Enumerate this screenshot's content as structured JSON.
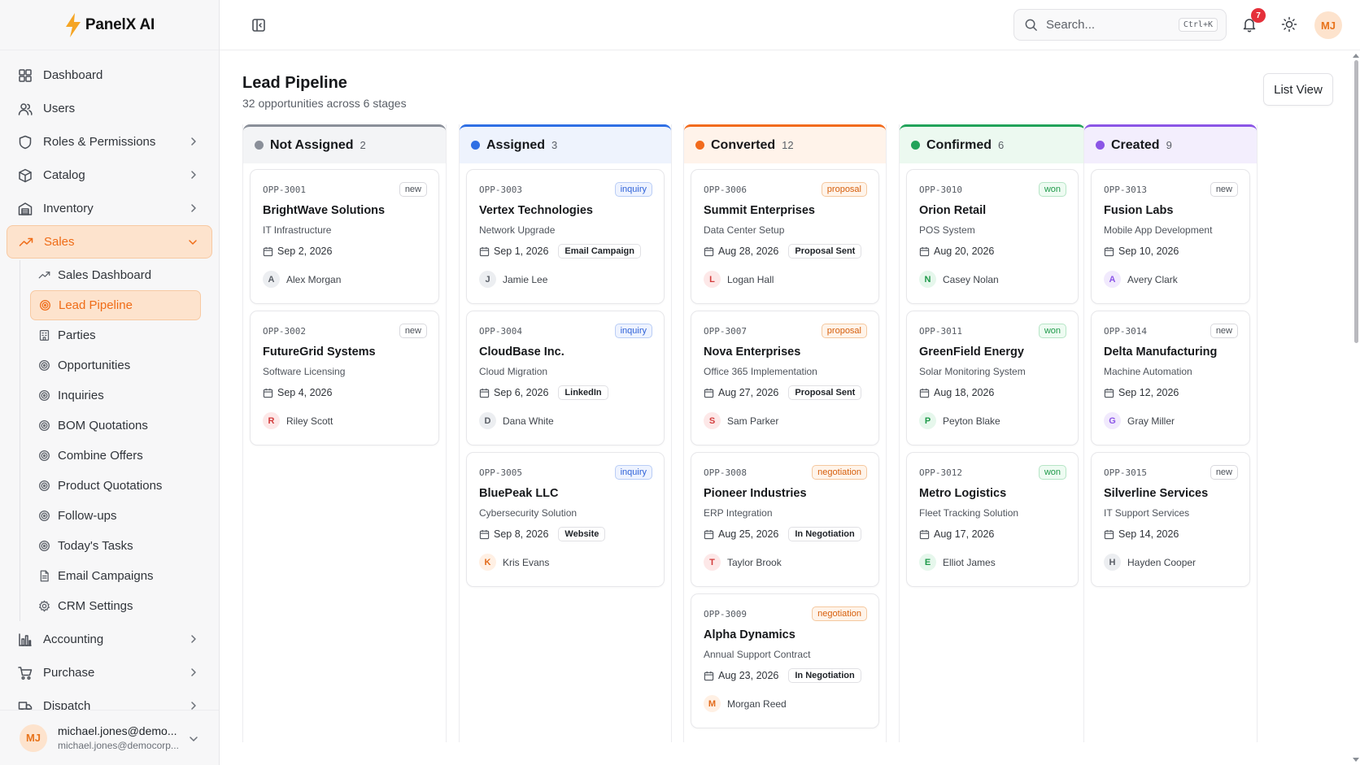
{
  "app": {
    "name": "PanelX AI"
  },
  "sidebar": {
    "items": [
      {
        "label": "Dashboard",
        "icon": "dashboard-icon",
        "has_chevron": false
      },
      {
        "label": "Users",
        "icon": "users-icon",
        "has_chevron": false
      },
      {
        "label": "Roles & Permissions",
        "icon": "shield-icon",
        "has_chevron": true
      },
      {
        "label": "Catalog",
        "icon": "box-icon",
        "has_chevron": true
      },
      {
        "label": "Inventory",
        "icon": "warehouse-icon",
        "has_chevron": true
      },
      {
        "label": "Sales",
        "icon": "trending-up-icon",
        "has_chevron": true,
        "expanded": true,
        "active": true
      }
    ],
    "sales_sub": [
      {
        "label": "Sales Dashboard",
        "icon": "trending-up-icon"
      },
      {
        "label": "Lead Pipeline",
        "icon": "target-icon",
        "active": true
      },
      {
        "label": "Parties",
        "icon": "building-icon"
      },
      {
        "label": "Opportunities",
        "icon": "target-icon"
      },
      {
        "label": "Inquiries",
        "icon": "target-icon"
      },
      {
        "label": "BOM Quotations",
        "icon": "target-icon"
      },
      {
        "label": "Combine Offers",
        "icon": "target-icon"
      },
      {
        "label": "Product Quotations",
        "icon": "target-icon"
      },
      {
        "label": "Follow-ups",
        "icon": "target-icon"
      },
      {
        "label": "Today's Tasks",
        "icon": "target-icon"
      },
      {
        "label": "Email Campaigns",
        "icon": "document-icon"
      },
      {
        "label": "CRM Settings",
        "icon": "gear-icon"
      }
    ],
    "items_after": [
      {
        "label": "Accounting",
        "icon": "bar-chart-icon",
        "has_chevron": true
      },
      {
        "label": "Purchase",
        "icon": "cart-icon",
        "has_chevron": true
      },
      {
        "label": "Dispatch",
        "icon": "truck-icon",
        "has_chevron": true
      }
    ],
    "user": {
      "initials": "MJ",
      "name": "michael.jones@demo...",
      "email": "michael.jones@democorp..."
    }
  },
  "topbar": {
    "search_placeholder": "Search...",
    "shortcut": "Ctrl+K",
    "notification_count": "7",
    "avatar_initials": "MJ"
  },
  "page": {
    "title": "Lead Pipeline",
    "subtitle": "32 opportunities across 6 stages",
    "list_view_label": "List View"
  },
  "colors": {
    "accent": "#ef6c17",
    "not_assigned": "#8a8f99",
    "assigned": "#2f6fe4",
    "converted": "#f26b1d",
    "confirmed": "#22a35a",
    "created": "#8b55e6"
  },
  "columns": [
    {
      "title": "Not Assigned",
      "count": "2",
      "color": "#8a8f99",
      "head_bg": "#f3f4f6",
      "cards": [
        {
          "id": "OPP-3001",
          "tag": "new",
          "tag_type": "new",
          "name": "BrightWave Solutions",
          "desc": "IT Infrastructure",
          "date": "Sep 2, 2026",
          "source": "",
          "initial": "A",
          "owner": "Alex Morgan",
          "av_bg": "#eceef1",
          "av_fg": "#5a5f67"
        },
        {
          "id": "OPP-3002",
          "tag": "new",
          "tag_type": "new",
          "name": "FutureGrid Systems",
          "desc": "Software Licensing",
          "date": "Sep 4, 2026",
          "source": "",
          "initial": "R",
          "owner": "Riley Scott",
          "av_bg": "#fde8e8",
          "av_fg": "#d23c3c"
        }
      ]
    },
    {
      "title": "Assigned",
      "count": "3",
      "color": "#2f6fe4",
      "head_bg": "#eef3fd",
      "cards": [
        {
          "id": "OPP-3003",
          "tag": "inquiry",
          "tag_type": "inquiry",
          "name": "Vertex Technologies",
          "desc": "Network Upgrade",
          "date": "Sep 1, 2026",
          "source": "Email Campaign",
          "initial": "J",
          "owner": "Jamie Lee",
          "av_bg": "#eceef1",
          "av_fg": "#5a5f67"
        },
        {
          "id": "OPP-3004",
          "tag": "inquiry",
          "tag_type": "inquiry",
          "name": "CloudBase Inc.",
          "desc": "Cloud Migration",
          "date": "Sep 6, 2026",
          "source": "LinkedIn",
          "initial": "D",
          "owner": "Dana White",
          "av_bg": "#eceef1",
          "av_fg": "#5a5f67"
        },
        {
          "id": "OPP-3005",
          "tag": "inquiry",
          "tag_type": "inquiry",
          "name": "BluePeak LLC",
          "desc": "Cybersecurity Solution",
          "date": "Sep 8, 2026",
          "source": "Website",
          "initial": "K",
          "owner": "Kris Evans",
          "av_bg": "#fff0e4",
          "av_fg": "#e26a1a"
        }
      ]
    },
    {
      "title": "Converted",
      "count": "12",
      "color": "#f26b1d",
      "head_bg": "#fff3ea",
      "cards": [
        {
          "id": "OPP-3006",
          "tag": "proposal",
          "tag_type": "proposal",
          "name": "Summit Enterprises",
          "desc": "Data Center Setup",
          "date": "Aug 28, 2026",
          "source": "Proposal Sent",
          "initial": "L",
          "owner": "Logan Hall",
          "av_bg": "#fde8e8",
          "av_fg": "#d23c3c"
        },
        {
          "id": "OPP-3007",
          "tag": "proposal",
          "tag_type": "proposal",
          "name": "Nova Enterprises",
          "desc": "Office 365 Implementation",
          "date": "Aug 27, 2026",
          "source": "Proposal Sent",
          "initial": "S",
          "owner": "Sam Parker",
          "av_bg": "#fde8e8",
          "av_fg": "#d23c3c"
        },
        {
          "id": "OPP-3008",
          "tag": "negotiation",
          "tag_type": "negotiation",
          "name": "Pioneer Industries",
          "desc": "ERP Integration",
          "date": "Aug 25, 2026",
          "source": "In Negotiation",
          "initial": "T",
          "owner": "Taylor Brook",
          "av_bg": "#fde8e8",
          "av_fg": "#d23c3c"
        },
        {
          "id": "OPP-3009",
          "tag": "negotiation",
          "tag_type": "negotiation",
          "name": "Alpha Dynamics",
          "desc": "Annual Support Contract",
          "date": "Aug 23, 2026",
          "source": "In Negotiation",
          "initial": "M",
          "owner": "Morgan Reed",
          "av_bg": "#fff0e4",
          "av_fg": "#e26a1a"
        }
      ]
    },
    {
      "title": "Confirmed",
      "count": "6",
      "color": "#22a35a",
      "head_bg": "#ecf9f0",
      "cards": [
        {
          "id": "OPP-3010",
          "tag": "won",
          "tag_type": "won",
          "name": "Orion Retail",
          "desc": "POS System",
          "date": "Aug 20, 2026",
          "source": "",
          "initial": "N",
          "owner": "Casey Nolan",
          "av_bg": "#e6f7ec",
          "av_fg": "#1f9a4a"
        },
        {
          "id": "OPP-3011",
          "tag": "won",
          "tag_type": "won",
          "name": "GreenField Energy",
          "desc": "Solar Monitoring System",
          "date": "Aug 18, 2026",
          "source": "",
          "initial": "P",
          "owner": "Peyton Blake",
          "av_bg": "#e6f7ec",
          "av_fg": "#1f9a4a"
        },
        {
          "id": "OPP-3012",
          "tag": "won",
          "tag_type": "won",
          "name": "Metro Logistics",
          "desc": "Fleet Tracking Solution",
          "date": "Aug 17, 2026",
          "source": "",
          "initial": "E",
          "owner": "Elliot James",
          "av_bg": "#e6f7ec",
          "av_fg": "#1f9a4a"
        }
      ]
    },
    {
      "title": "Created",
      "count": "9",
      "color": "#8b55e6",
      "head_bg": "#f3eefd",
      "cards": [
        {
          "id": "OPP-3013",
          "tag": "new",
          "tag_type": "new",
          "name": "Fusion Labs",
          "desc": "Mobile App Development",
          "date": "Sep 10, 2026",
          "source": "",
          "initial": "A",
          "owner": "Avery Clark",
          "av_bg": "#f1eafd",
          "av_fg": "#8b55e6"
        },
        {
          "id": "OPP-3014",
          "tag": "new",
          "tag_type": "new",
          "name": "Delta Manufacturing",
          "desc": "Machine Automation",
          "date": "Sep 12, 2026",
          "source": "",
          "initial": "G",
          "owner": "Gray Miller",
          "av_bg": "#f1eafd",
          "av_fg": "#8b55e6"
        },
        {
          "id": "OPP-3015",
          "tag": "new",
          "tag_type": "new",
          "name": "Silverline Services",
          "desc": "IT Support Services",
          "date": "Sep 14, 2026",
          "source": "",
          "initial": "H",
          "owner": "Hayden Cooper",
          "av_bg": "#eceef1",
          "av_fg": "#5a5f67"
        }
      ]
    }
  ]
}
